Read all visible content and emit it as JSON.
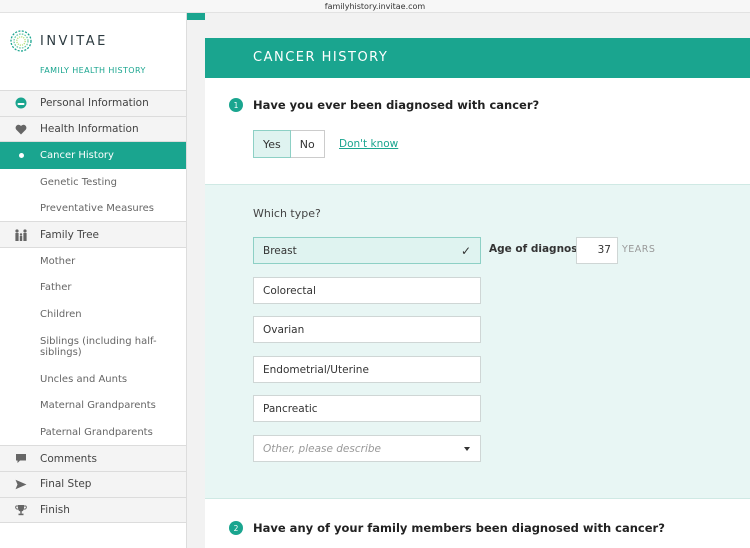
{
  "browser": {
    "url": "familyhistory.invitae.com"
  },
  "brand": {
    "name": "INVITAE",
    "subtitle": "FAMILY HEALTH HISTORY"
  },
  "sidebar": {
    "items": [
      {
        "label": "Personal Information",
        "icon": "face-icon",
        "kind": "section"
      },
      {
        "label": "Health Information",
        "icon": "heart-icon",
        "kind": "section"
      },
      {
        "label": "Cancer History",
        "kind": "sub",
        "active": true
      },
      {
        "label": "Genetic Testing",
        "kind": "sub"
      },
      {
        "label": "Preventative Measures",
        "kind": "sub"
      },
      {
        "label": "Family Tree",
        "icon": "family-icon",
        "kind": "section"
      },
      {
        "label": "Mother",
        "kind": "sub"
      },
      {
        "label": "Father",
        "kind": "sub"
      },
      {
        "label": "Children",
        "kind": "sub"
      },
      {
        "label": "Siblings (including half-siblings)",
        "kind": "sub"
      },
      {
        "label": "Uncles and Aunts",
        "kind": "sub"
      },
      {
        "label": "Maternal Grandparents",
        "kind": "sub"
      },
      {
        "label": "Paternal Grandparents",
        "kind": "sub"
      },
      {
        "label": "Comments",
        "icon": "comment-icon",
        "kind": "section"
      },
      {
        "label": "Final Step",
        "icon": "send-icon",
        "kind": "section"
      },
      {
        "label": "Finish",
        "icon": "trophy-icon",
        "kind": "section"
      }
    ]
  },
  "main": {
    "header": "CANCER HISTORY",
    "q1": {
      "number": "1",
      "text": "Have you ever been diagnosed with cancer?"
    },
    "answers": {
      "yes": "Yes",
      "no": "No",
      "dont_know": "Don't know",
      "selected": "Yes"
    },
    "which_type": "Which type?",
    "types": [
      {
        "label": "Breast",
        "selected": true
      },
      {
        "label": "Colorectal"
      },
      {
        "label": "Ovarian"
      },
      {
        "label": "Endometrial/Uterine"
      },
      {
        "label": "Pancreatic"
      }
    ],
    "other_placeholder": "Other, please describe",
    "age": {
      "label": "Age of diagnosis",
      "value": "37",
      "unit": "YEARS"
    },
    "q2": {
      "number": "2",
      "text": "Have any of your family members been diagnosed with cancer?"
    }
  },
  "colors": {
    "accent": "#1aa58f",
    "panel": "#e8f6f4"
  }
}
